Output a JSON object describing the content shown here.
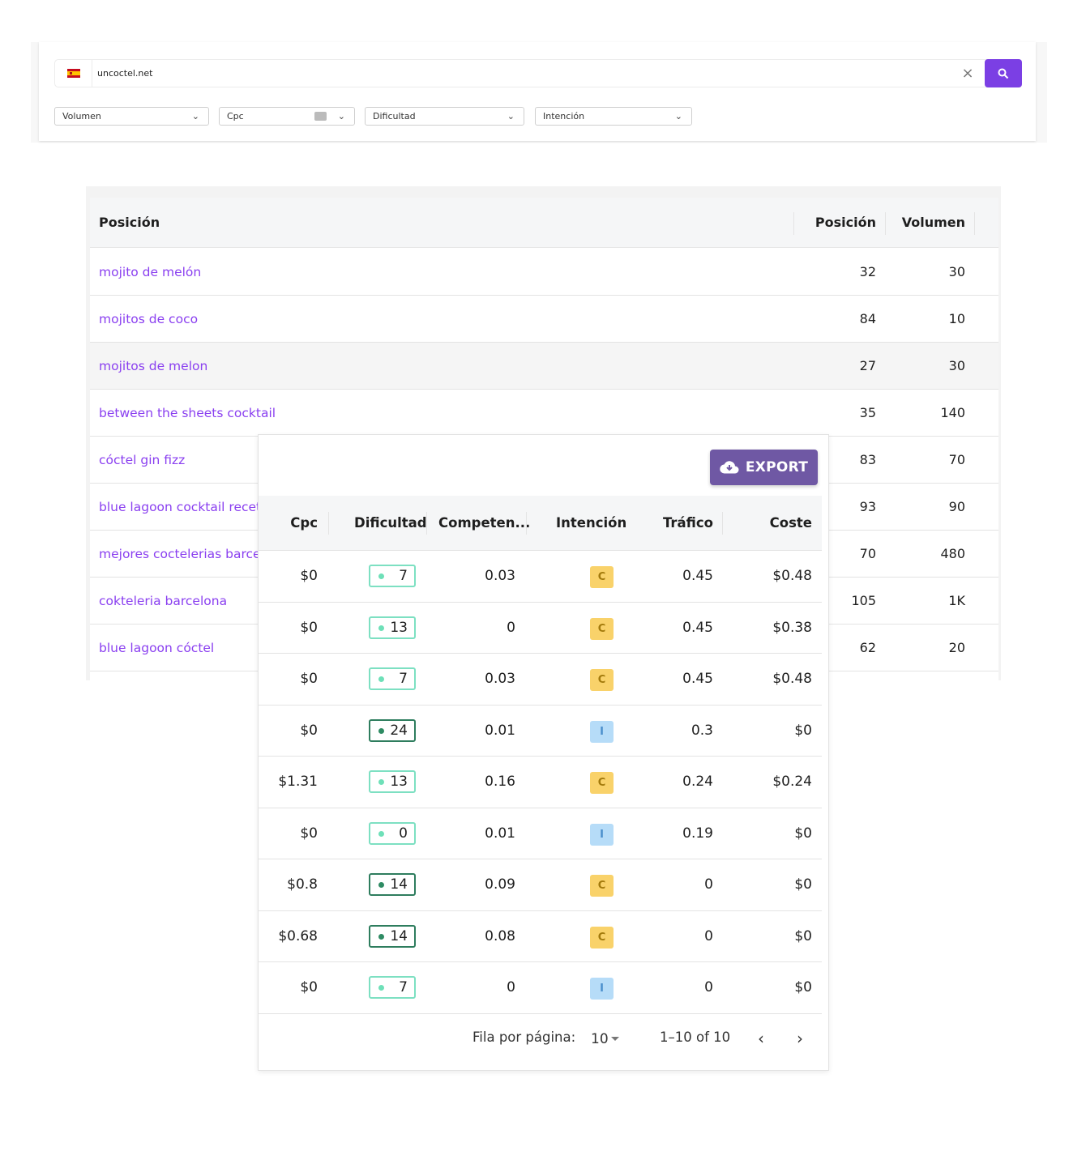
{
  "search": {
    "domain": "uncoctel.net",
    "filters": [
      "Volumen",
      "Cpc",
      "Dificultad",
      "Intención"
    ]
  },
  "back_table": {
    "headers": [
      "Posición",
      "Posición",
      "Volumen"
    ],
    "rows": [
      {
        "keyword": "mojito de melón",
        "position": "32",
        "volume": "30"
      },
      {
        "keyword": "mojitos de coco",
        "position": "84",
        "volume": "10"
      },
      {
        "keyword": "mojitos de melon",
        "position": "27",
        "volume": "30"
      },
      {
        "keyword": "between the sheets cocktail",
        "position": "35",
        "volume": "140"
      },
      {
        "keyword": "cóctel gin fizz",
        "position": "83",
        "volume": "70"
      },
      {
        "keyword": "blue lagoon cocktail receta",
        "position": "93",
        "volume": "90"
      },
      {
        "keyword": "mejores coctelerias barcelona",
        "position": "70",
        "volume": "480"
      },
      {
        "keyword": "cokteleria barcelona",
        "position": "105",
        "volume": "1K"
      },
      {
        "keyword": "blue lagoon cóctel",
        "position": "62",
        "volume": "20"
      }
    ]
  },
  "front_table": {
    "export_label": "EXPORT",
    "headers": [
      "Cpc",
      "Dificultad",
      "Competen...",
      "Intención",
      "Tráfico",
      "Coste"
    ],
    "rows": [
      {
        "cpc": "$0",
        "difficulty": "7",
        "competition": "0.03",
        "intent": "C",
        "traffic": "0.45",
        "cost": "$0.48"
      },
      {
        "cpc": "$0",
        "difficulty": "13",
        "competition": "0",
        "intent": "C",
        "traffic": "0.45",
        "cost": "$0.38"
      },
      {
        "cpc": "$0",
        "difficulty": "7",
        "competition": "0.03",
        "intent": "C",
        "traffic": "0.45",
        "cost": "$0.48"
      },
      {
        "cpc": "$0",
        "difficulty": "24",
        "competition": "0.01",
        "intent": "I",
        "traffic": "0.3",
        "cost": "$0"
      },
      {
        "cpc": "$1.31",
        "difficulty": "13",
        "competition": "0.16",
        "intent": "C",
        "traffic": "0.24",
        "cost": "$0.24"
      },
      {
        "cpc": "$0",
        "difficulty": "0",
        "competition": "0.01",
        "intent": "I",
        "traffic": "0.19",
        "cost": "$0"
      },
      {
        "cpc": "$0.8",
        "difficulty": "14",
        "competition": "0.09",
        "intent": "C",
        "traffic": "0",
        "cost": "$0"
      },
      {
        "cpc": "$0.68",
        "difficulty": "14",
        "competition": "0.08",
        "intent": "C",
        "traffic": "0",
        "cost": "$0"
      },
      {
        "cpc": "$0",
        "difficulty": "7",
        "competition": "0",
        "intent": "I",
        "traffic": "0",
        "cost": "$0"
      }
    ],
    "pagination": {
      "rows_per_page_label": "Fila por página:",
      "rows_per_page": "10",
      "range": "1–10 of 10"
    }
  },
  "colors": {
    "accent": "#7b3fe4",
    "keyword_link": "#8a3ff0",
    "export_button": "#6f58a4",
    "intent_commercial": "#f9d26a",
    "intent_informational": "#b6dcf8"
  }
}
